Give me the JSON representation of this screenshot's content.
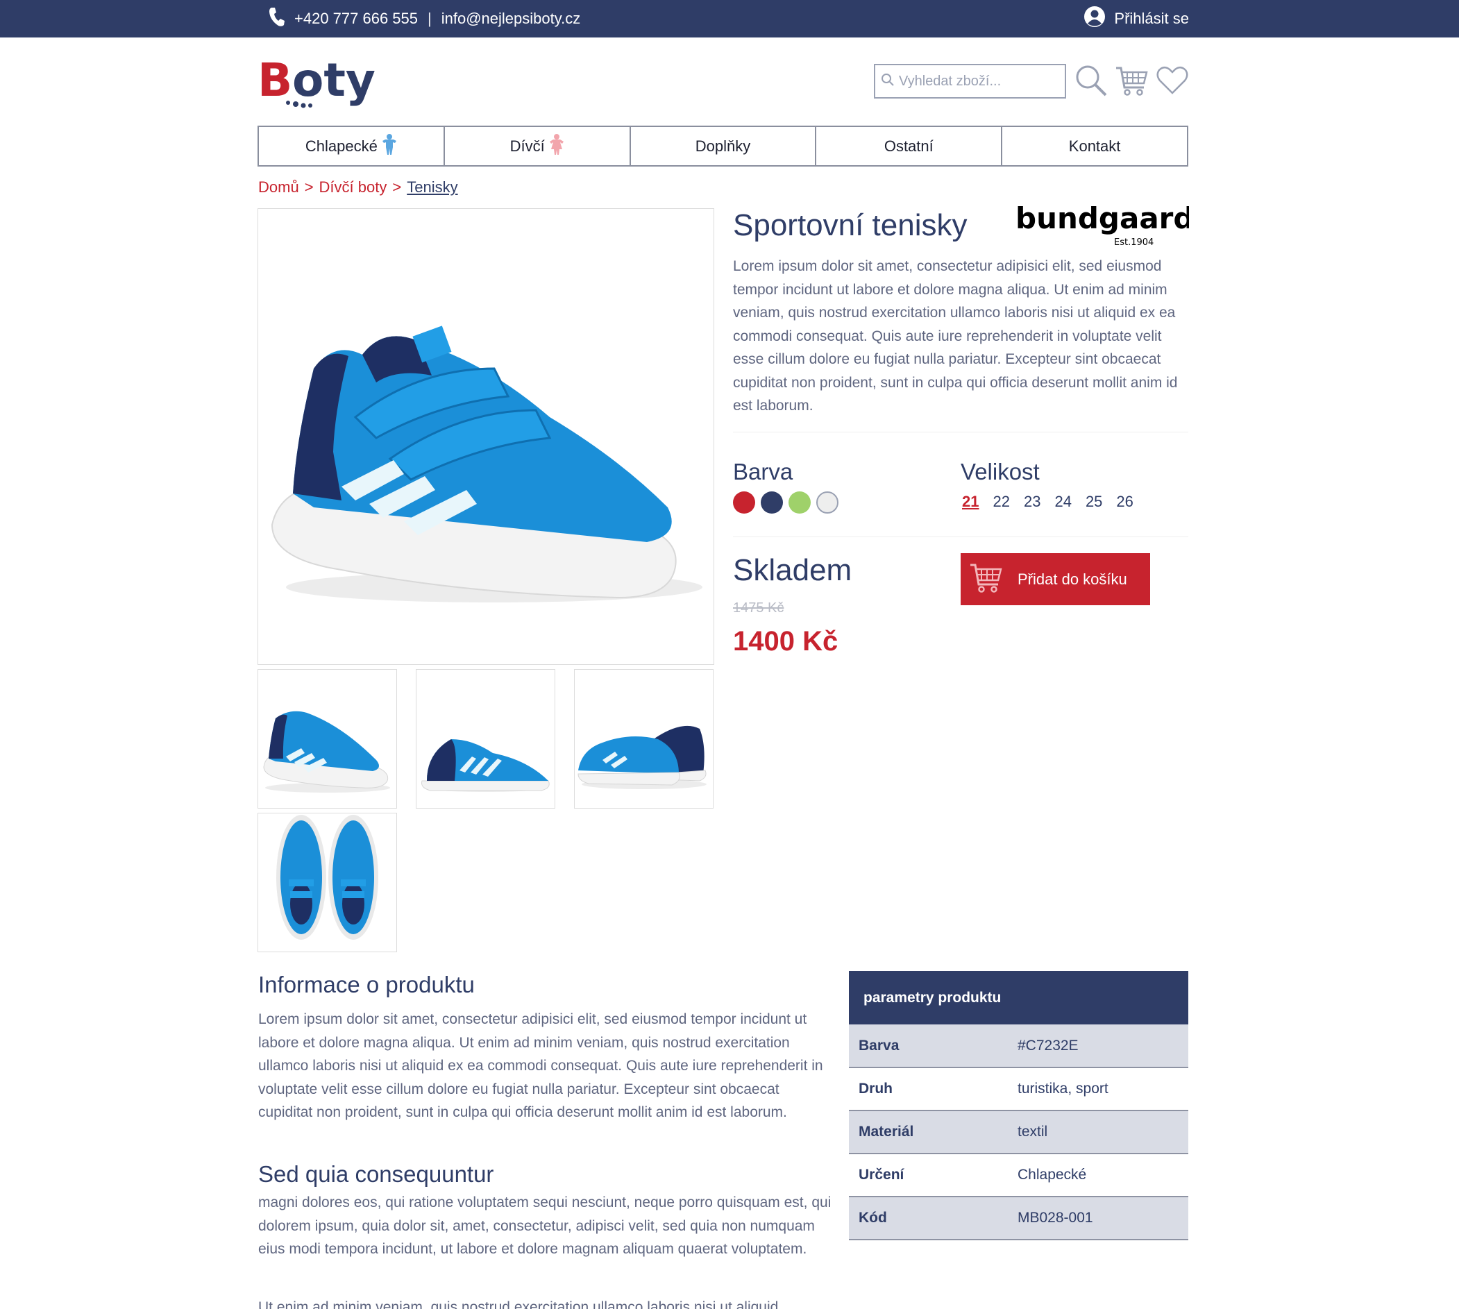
{
  "topbar": {
    "phone": "+420 777 666 555",
    "separator": "|",
    "email": "info@nejlepsiboty.cz",
    "login": "Přihlásit se"
  },
  "header": {
    "logo_text": "Boty",
    "search_placeholder": "Vyhledat zboží..."
  },
  "nav": [
    {
      "label": "Chlapecké",
      "icon": "boy-icon"
    },
    {
      "label": "Dívčí",
      "icon": "girl-icon"
    },
    {
      "label": "Doplňky"
    },
    {
      "label": "Ostatní"
    },
    {
      "label": "Kontakt"
    }
  ],
  "breadcrumb": {
    "home": "Domů",
    "sep1": ">",
    "category": "Dívčí boty",
    "sep2": ">",
    "current": "Tenisky"
  },
  "product": {
    "title": "Sportovní tenisky",
    "brand": "bundgaard",
    "brand_est": "Est.1904",
    "description": "Lorem ipsum dolor sit amet, consectetur adipisici elit, sed eiusmod tempor incidunt ut labore et dolore magna aliqua. Ut enim ad minim veniam, quis nostrud exercitation ullamco laboris nisi ut aliquid ex ea commodi consequat. Quis aute iure reprehenderit in voluptate velit esse cillum dolore eu fugiat nulla pariatur. Excepteur sint obcaecat cupiditat non proident, sunt in culpa qui officia deserunt mollit anim id est laborum.",
    "color_label": "Barva",
    "colors": [
      "#c7232e",
      "#2f3d67",
      "#9fd16a",
      "#eeeeee"
    ],
    "size_label": "Velikost",
    "sizes": [
      "21",
      "22",
      "23",
      "24",
      "25",
      "26"
    ],
    "selected_size": "21",
    "stock": "Skladem",
    "old_price": "1475 Kč",
    "price": "1400 Kč",
    "cart_button": "Přidat do košíku"
  },
  "info": {
    "heading1": "Informace o produktu",
    "para1": "Lorem ipsum dolor sit amet, consectetur adipisici elit, sed eiusmod tempor incidunt ut labore et dolore magna aliqua. Ut enim ad minim veniam, quis nostrud exercitation ullamco laboris nisi ut aliquid ex ea commodi consequat. Quis aute iure reprehenderit in voluptate velit esse cillum dolore eu fugiat nulla pariatur. Excepteur sint obcaecat cupiditat non proident, sunt in culpa qui officia deserunt mollit anim id est laborum.",
    "heading2": "Sed quia consequuntur",
    "para2": "magni dolores eos, qui ratione voluptatem sequi nesciunt, neque porro quisquam est, qui dolorem ipsum, quia dolor sit, amet, consectetur, adipisci velit, sed quia non numquam eius modi tempora incidunt, ut labore et dolore magnam aliquam quaerat voluptatem.",
    "para3": "Ut enim ad minim veniam, quis nostrud exercitation ullamco laboris nisi ut aliquid"
  },
  "params": {
    "title": "parametry produktu",
    "rows": [
      {
        "key": "Barva",
        "value": "#C7232E"
      },
      {
        "key": "Druh",
        "value": "turistika, sport"
      },
      {
        "key": "Materiál",
        "value": "textil"
      },
      {
        "key": "Určení",
        "value": "Chlapecké"
      },
      {
        "key": "Kód",
        "value": "MB028-001"
      }
    ]
  },
  "colors": {
    "navy": "#2f3d67",
    "red": "#c7232e",
    "text_gray": "#5f6680",
    "table_shade": "#d9dce5"
  }
}
